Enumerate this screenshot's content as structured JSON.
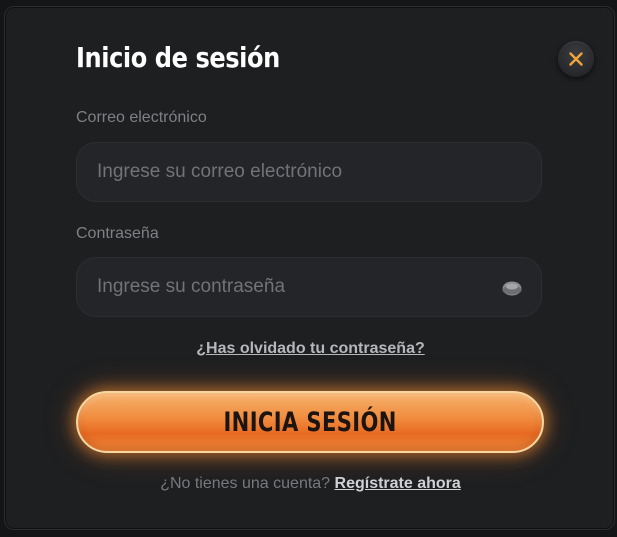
{
  "modal": {
    "title": "Inicio de sesión",
    "close_icon": "close-icon",
    "accent_color": "#f08a3c"
  },
  "email": {
    "label": "Correo electrónico",
    "placeholder": "Ingrese su correo electrónico",
    "value": ""
  },
  "password": {
    "label": "Contraseña",
    "placeholder": "Ingrese su contraseña",
    "value": "",
    "toggle_icon": "eye-icon"
  },
  "forgot_password": {
    "label": "¿Has olvidado tu contraseña?"
  },
  "login_button": {
    "label": "INICIA SESIÓN"
  },
  "register": {
    "prompt": "¿No tienes una cuenta?",
    "link_label": "Regístrate ahora"
  }
}
